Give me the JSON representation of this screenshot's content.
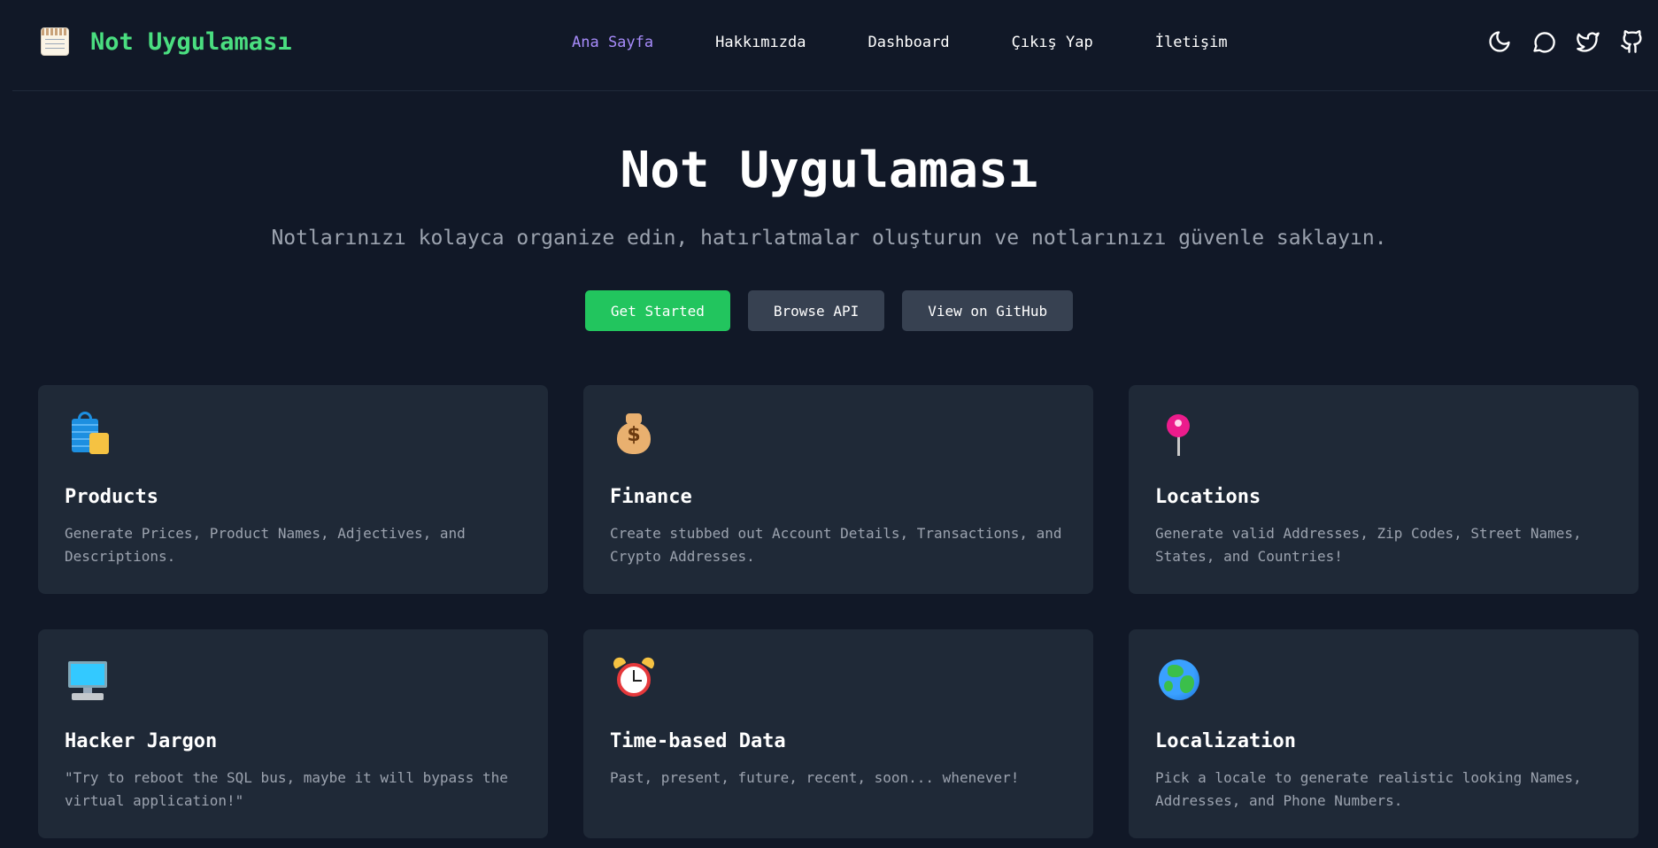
{
  "header": {
    "brand": "Not Uygulaması",
    "nav": [
      {
        "label": "Ana Sayfa",
        "active": true
      },
      {
        "label": "Hakkımızda",
        "active": false
      },
      {
        "label": "Dashboard",
        "active": false
      },
      {
        "label": "Çıkış Yap",
        "active": false
      },
      {
        "label": "İletişim",
        "active": false
      }
    ],
    "icons": [
      "moon-icon",
      "chat-icon",
      "twitter-icon",
      "github-icon"
    ]
  },
  "hero": {
    "title": "Not Uygulaması",
    "subtitle": "Notlarınızı kolayca organize edin, hatırlatmalar oluşturun ve notlarınızı güvenle saklayın.",
    "buttons": {
      "primary": "Get Started",
      "api": "Browse API",
      "github": "View on GitHub"
    }
  },
  "features": [
    {
      "icon": "shopping-bags-icon",
      "title": "Products",
      "desc": "Generate Prices, Product Names, Adjectives, and Descriptions."
    },
    {
      "icon": "money-bag-icon",
      "title": "Finance",
      "desc": "Create stubbed out Account Details, Transactions, and Crypto Addresses."
    },
    {
      "icon": "round-pushpin-icon",
      "title": "Locations",
      "desc": "Generate valid Addresses, Zip Codes, Street Names, States, and Countries!"
    },
    {
      "icon": "desktop-computer-icon",
      "title": "Hacker Jargon",
      "desc": "\"Try to reboot the SQL bus, maybe it will bypass the virtual application!\""
    },
    {
      "icon": "alarm-clock-icon",
      "title": "Time-based Data",
      "desc": "Past, present, future, recent, soon... whenever!"
    },
    {
      "icon": "globe-icon",
      "title": "Localization",
      "desc": "Pick a locale to generate realistic looking Names, Addresses, and Phone Numbers."
    }
  ],
  "colors": {
    "background": "#111827",
    "card": "#1f2937",
    "brand": "#4ade80",
    "active_nav": "#a78bfa",
    "primary_button": "#22c55e",
    "secondary_button": "#374151",
    "muted_text": "#9ca3af"
  }
}
